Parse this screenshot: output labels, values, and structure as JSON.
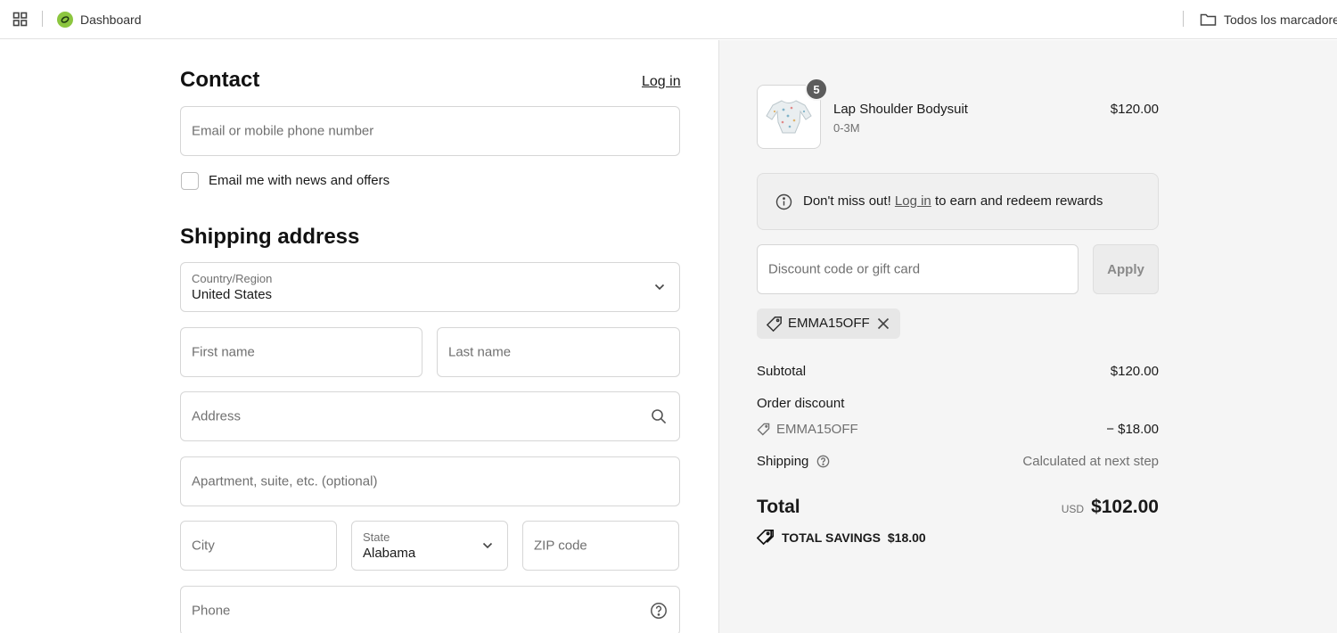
{
  "bookmarks": {
    "dashboard_label": "Dashboard",
    "folder_label": "Todos los marcadores"
  },
  "contact": {
    "heading": "Contact",
    "login_link": "Log in",
    "email_placeholder": "Email or mobile phone number",
    "newsletter_label": "Email me with news and offers"
  },
  "shipping": {
    "heading": "Shipping address",
    "country_label": "Country/Region",
    "country_value": "United States",
    "first_name_placeholder": "First name",
    "last_name_placeholder": "Last name",
    "address_placeholder": "Address",
    "apartment_placeholder": "Apartment, suite, etc. (optional)",
    "city_placeholder": "City",
    "state_label": "State",
    "state_value": "Alabama",
    "zip_placeholder": "ZIP code",
    "phone_placeholder": "Phone"
  },
  "summary": {
    "product": {
      "name": "Lap Shoulder Bodysuit",
      "variant": "0-3M",
      "price": "$120.00",
      "quantity": "5"
    },
    "rewards": {
      "prefix": "Don't miss out!",
      "link": "Log in",
      "suffix": "to earn and redeem rewards"
    },
    "discount_placeholder": "Discount code or gift card",
    "apply_label": "Apply",
    "applied_code": "EMMA15OFF",
    "subtotal_label": "Subtotal",
    "subtotal_value": "$120.00",
    "order_discount_label": "Order discount",
    "discount_code": "EMMA15OFF",
    "discount_value": "− $18.00",
    "shipping_label": "Shipping",
    "shipping_value": "Calculated at next step",
    "total_label": "Total",
    "currency": "USD",
    "total_value": "$102.00",
    "savings_label": "TOTAL SAVINGS",
    "savings_value": "$18.00"
  },
  "colors": {
    "summary_bg": "#f5f5f5",
    "border": "#d6d6d6",
    "placeholder": "#707070"
  }
}
